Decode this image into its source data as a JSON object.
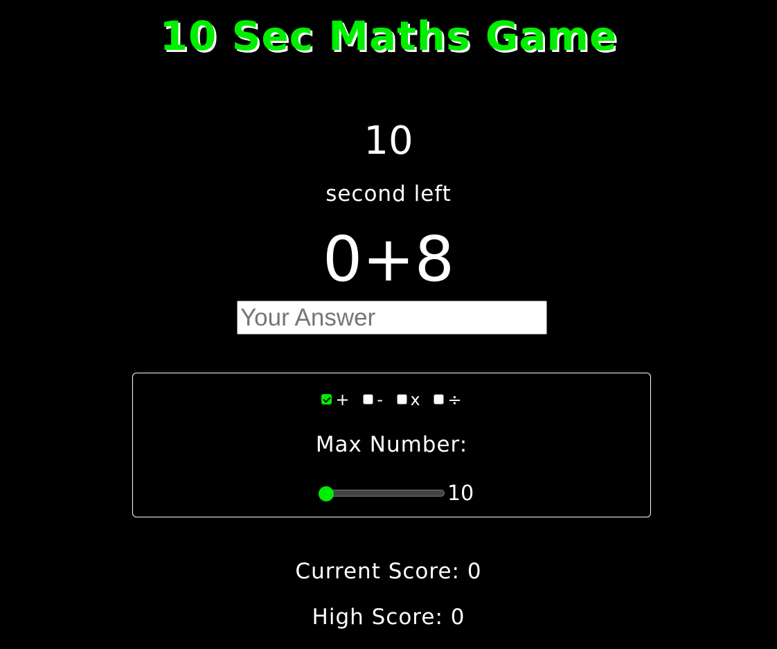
{
  "title": "10 Sec Maths Game",
  "timer": {
    "value": "10",
    "label": "second left"
  },
  "question": "0+8",
  "answer": {
    "value": "",
    "placeholder": "Your Answer"
  },
  "settings": {
    "operations": [
      {
        "symbol": "+",
        "checked": true
      },
      {
        "symbol": "-",
        "checked": false
      },
      {
        "symbol": "x",
        "checked": false
      },
      {
        "symbol": "÷",
        "checked": false
      }
    ],
    "max_number_label": "Max Number:",
    "max_number": {
      "value": "10",
      "fraction": 0
    }
  },
  "scores": {
    "current": "Current Score: 0",
    "high": "High Score: 0"
  },
  "colors": {
    "background": "#000000",
    "accent": "#00ee00",
    "text": "#ffffff"
  }
}
